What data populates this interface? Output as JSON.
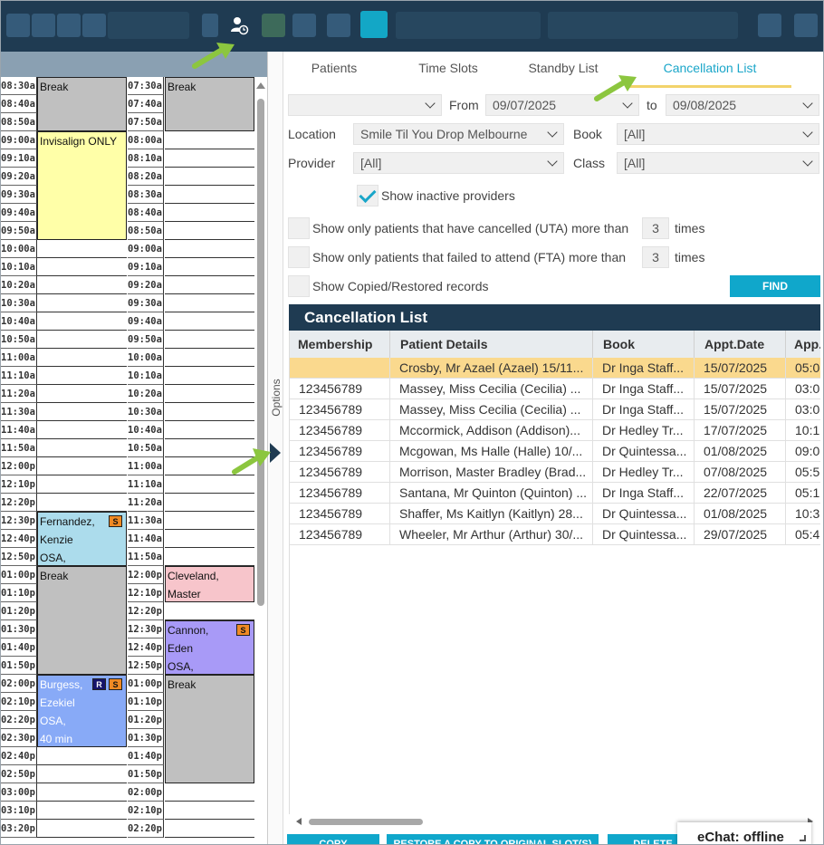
{
  "colors": {
    "navy": "#1f3b52",
    "accent": "#10a7cb",
    "selected_row": "#fad98e",
    "break": "#c0c0c0",
    "invisalign": "#ffffa8",
    "light_blue_appt": "#acdcec",
    "pink_appt": "#f7c5cb",
    "purple_appt": "#a89af7",
    "blue_appt": "#88aaf7",
    "pointer": "#8cc63f"
  },
  "calendar": {
    "col1_times": [
      "08:30a",
      "08:40a",
      "08:50a",
      "09:00a",
      "09:10a",
      "09:20a",
      "09:30a",
      "09:40a",
      "09:50a",
      "10:00a",
      "10:10a",
      "10:20a",
      "10:30a",
      "10:40a",
      "10:50a",
      "11:00a",
      "11:10a",
      "11:20a",
      "11:30a",
      "11:40a",
      "11:50a",
      "12:00p",
      "12:10p",
      "12:20p",
      "12:30p",
      "12:40p",
      "12:50p",
      "01:00p",
      "01:10p",
      "01:20p",
      "01:30p",
      "01:40p",
      "01:50p",
      "02:00p",
      "02:10p",
      "02:20p",
      "02:30p",
      "02:40p",
      "02:50p",
      "03:00p",
      "03:10p",
      "03:20p"
    ],
    "col2_times": [
      "07:30a",
      "07:40a",
      "07:50a",
      "08:00a",
      "08:10a",
      "08:20a",
      "08:30a",
      "08:40a",
      "08:50a",
      "09:00a",
      "09:10a",
      "09:20a",
      "09:30a",
      "09:40a",
      "09:50a",
      "10:00a",
      "10:10a",
      "10:20a",
      "10:30a",
      "10:40a",
      "10:50a",
      "11:00a",
      "11:10a",
      "11:20a",
      "11:30a",
      "11:40a",
      "11:50a",
      "12:00p",
      "12:10p",
      "12:20p",
      "12:30p",
      "12:40p",
      "12:50p",
      "01:00p",
      "01:10p",
      "01:20p",
      "01:30p",
      "01:40p",
      "01:50p",
      "02:00p",
      "02:10p",
      "02:20p"
    ],
    "col1_appts": [
      {
        "start": 0,
        "span": 3,
        "lines": [
          "Break"
        ],
        "color": "#c0c0c0"
      },
      {
        "start": 3,
        "span": 6,
        "lines": [
          "Invisalign ONLY"
        ],
        "color": "#ffffa8"
      },
      {
        "start": 24,
        "span": 3,
        "lines": [
          "Fernandez,",
          "Kenzie",
          "OSA,"
        ],
        "color": "#acdcec",
        "badges": [
          "S"
        ]
      },
      {
        "start": 27,
        "span": 6,
        "lines": [
          "Break"
        ],
        "color": "#c0c0c0"
      },
      {
        "start": 33,
        "span": 4,
        "lines": [
          "Burgess,",
          "Ezekiel",
          "OSA,",
          "40 min"
        ],
        "color": "#88aaf7",
        "badges": [
          "R",
          "S"
        ],
        "light_text": true
      }
    ],
    "col2_appts": [
      {
        "start": 0,
        "span": 3,
        "lines": [
          "Break"
        ],
        "color": "#c0c0c0"
      },
      {
        "start": 27,
        "span": 2,
        "lines": [
          "Cleveland,",
          "Master"
        ],
        "color": "#f7c5cb"
      },
      {
        "start": 30,
        "span": 3,
        "lines": [
          "Cannon,",
          "Eden",
          "OSA,"
        ],
        "color": "#a89af7",
        "badges": [
          "S"
        ]
      },
      {
        "start": 33,
        "span": 6,
        "lines": [
          "Break"
        ],
        "color": "#c0c0c0"
      }
    ]
  },
  "options_label": "Options",
  "tabs": [
    {
      "label": "Patients",
      "active": false
    },
    {
      "label": "Time Slots",
      "active": false
    },
    {
      "label": "Standby List",
      "active": false
    },
    {
      "label": "Cancellation List",
      "active": true
    }
  ],
  "filters": {
    "first_select": "",
    "from_label": "From",
    "from_date": "09/07/2025",
    "to_label": "to",
    "to_date": "09/08/2025",
    "location_label": "Location",
    "location_value": "Smile Til You Drop Melbourne",
    "book_label": "Book",
    "book_value": "[All]",
    "provider_label": "Provider",
    "provider_value": "[All]",
    "class_label": "Class",
    "class_value": "[All]",
    "show_inactive_label": "Show inactive providers",
    "show_inactive_checked": true,
    "uta_label": "Show only patients that have cancelled (UTA) more than",
    "uta_count": "3",
    "fta_label": "Show only patients that failed to attend (FTA) more than",
    "fta_count": "3",
    "times_label": "times",
    "copied_label": "Show Copied/Restored records",
    "find_label": "FIND"
  },
  "grid": {
    "title": "Cancellation List",
    "columns": [
      "Membership",
      "Patient Details",
      "Book",
      "Appt.Date",
      "App."
    ],
    "rows": [
      [
        "",
        "Crosby, Mr Azael (Azael) 15/11...",
        "Dr Inga Staff...",
        "15/07/2025",
        "05:0"
      ],
      [
        "123456789",
        "Massey, Miss Cecilia (Cecilia) ...",
        "Dr Inga Staff...",
        "15/07/2025",
        "03:0"
      ],
      [
        "123456789",
        "Massey, Miss Cecilia (Cecilia) ...",
        "Dr Inga Staff...",
        "15/07/2025",
        "03:0"
      ],
      [
        "123456789",
        "Mccormick, Addison (Addison)...",
        "Dr Hedley Tr...",
        "17/07/2025",
        "10:1"
      ],
      [
        "123456789",
        "Mcgowan, Ms Halle (Halle) 10/...",
        "Dr Quintessa...",
        "01/08/2025",
        "09:0"
      ],
      [
        "123456789",
        "Morrison, Master Bradley (Brad...",
        "Dr Hedley Tr...",
        "07/08/2025",
        "05:5"
      ],
      [
        "123456789",
        "Santana, Mr Quinton (Quinton) ...",
        "Dr Inga Staff...",
        "22/07/2025",
        "05:1"
      ],
      [
        "123456789",
        "Shaffer, Ms Kaitlyn (Kaitlyn) 28...",
        "Dr Quintessa...",
        "01/08/2025",
        "10:3"
      ],
      [
        "123456789",
        "Wheeler, Mr Arthur (Arthur) 30/...",
        "Dr Quintessa...",
        "29/07/2025",
        "05:4"
      ]
    ],
    "selected_row": 0
  },
  "bottom_buttons": [
    "COPY",
    "RESTORE A COPY TO ORIGINAL SLOT(S)",
    "DELETE"
  ],
  "echat": "eChat: offline"
}
